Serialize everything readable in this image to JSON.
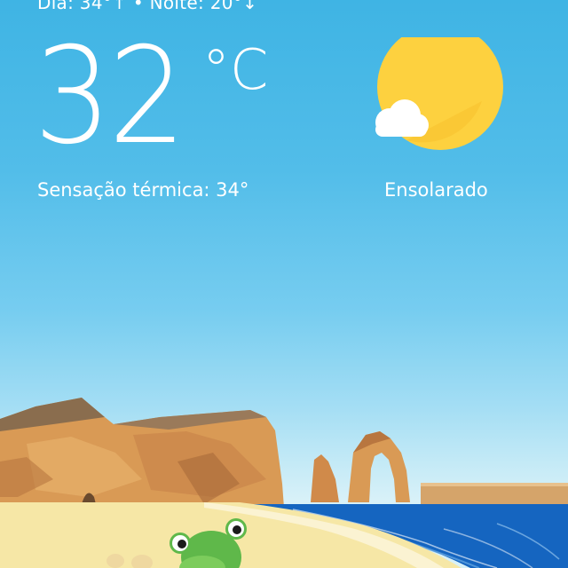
{
  "header": {
    "high_low": "Dia: 34°↑ • Noite: 20°↓"
  },
  "current": {
    "temperature": "32",
    "unit": "°C",
    "feels_like": "Sensação térmica: 34°",
    "condition": "Ensolarado"
  },
  "icons": {
    "weather": "sun-with-cloud-icon",
    "mascot": "frog-icon"
  },
  "colors": {
    "sky_top": "#3fb4e4",
    "sun": "#fdd13f",
    "sea": "#1565c0",
    "sand": "#f6e7a6",
    "cliffs": "#d99a55"
  }
}
